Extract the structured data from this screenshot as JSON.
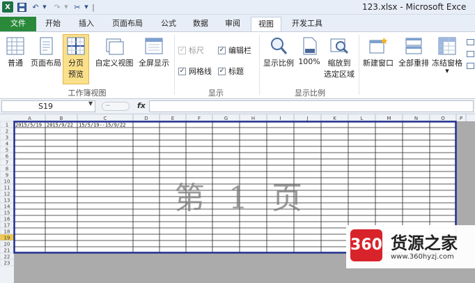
{
  "title_bar": {
    "app_icon": "excel-icon",
    "app_icon_letter": "X",
    "window_title": "123.xlsx - Microsoft Exce"
  },
  "tabs": [
    {
      "label": "文件",
      "name": "tab-file"
    },
    {
      "label": "开始",
      "name": "tab-home"
    },
    {
      "label": "插入",
      "name": "tab-insert"
    },
    {
      "label": "页面布局",
      "name": "tab-page-layout"
    },
    {
      "label": "公式",
      "name": "tab-formulas"
    },
    {
      "label": "数据",
      "name": "tab-data"
    },
    {
      "label": "审阅",
      "name": "tab-review"
    },
    {
      "label": "视图",
      "name": "tab-view"
    },
    {
      "label": "开发工具",
      "name": "tab-developer"
    }
  ],
  "ribbon": {
    "workbook_views": {
      "normal": "普通",
      "page_layout": "页面布局",
      "page_break_preview_line1": "分页",
      "page_break_preview_line2": "预览",
      "custom_views": "自定义视图",
      "full_screen": "全屏显示",
      "group_label": "工作簿视图"
    },
    "show": {
      "ruler": "标尺",
      "formula_bar": "编辑栏",
      "gridlines": "网格线",
      "headings": "标题",
      "group_label": "显示"
    },
    "zoom": {
      "zoom": "显示比例",
      "hundred": "100%",
      "zoom_to_selection_line1": "缩放到",
      "zoom_to_selection_line2": "选定区域",
      "group_label": "显示比例"
    },
    "window": {
      "new_window": "新建窗口",
      "arrange_all": "全部重排",
      "freeze_panes": "冻结窗格"
    }
  },
  "formula_bar": {
    "name_box": "S19",
    "fx": "fx"
  },
  "sheet": {
    "columns": [
      "A",
      "B",
      "C",
      "D",
      "E",
      "F",
      "G",
      "H",
      "I",
      "J",
      "K",
      "L",
      "M",
      "N",
      "O",
      "P"
    ],
    "rows": [
      "1",
      "2",
      "3",
      "4",
      "5",
      "6",
      "7",
      "8",
      "9",
      "10",
      "11",
      "12",
      "13",
      "14",
      "15",
      "16",
      "17",
      "18",
      "19",
      "20",
      "21",
      "22",
      "23"
    ],
    "cells": {
      "A1": "2015/5/19",
      "B1": "2015/9/22",
      "C1": "15/5/19--15/9/22"
    },
    "watermark": "第 1 页",
    "active_row": "19"
  },
  "logo": {
    "mark": "360",
    "name": "货源之家",
    "url": "www.360hyzj.com"
  },
  "colors": {
    "file_tab": "#2a8a3a",
    "page_border": "#1f2f8f",
    "logo_red": "#d8232a",
    "active_row_header": "#f0c850"
  }
}
